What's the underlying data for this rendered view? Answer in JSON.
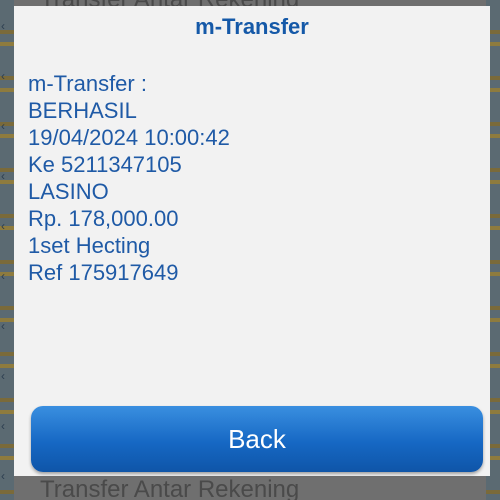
{
  "background": {
    "top_item": "Transfer Antar Rekening",
    "bottom_item": "Transfer Antar Rekening"
  },
  "dialog": {
    "title": "m-Transfer",
    "lines": [
      "m-Transfer :",
      "BERHASIL",
      "19/04/2024 10:00:42",
      "Ke 5211347105",
      "LASINO",
      "Rp. 178,000.00",
      "1set Hecting",
      "Ref 175917649"
    ],
    "back_label": "Back"
  },
  "colors": {
    "title": "#1559a8",
    "text": "#1f5aa6",
    "button": "#1668c4",
    "dialog_bg": "#f2f2f2"
  }
}
